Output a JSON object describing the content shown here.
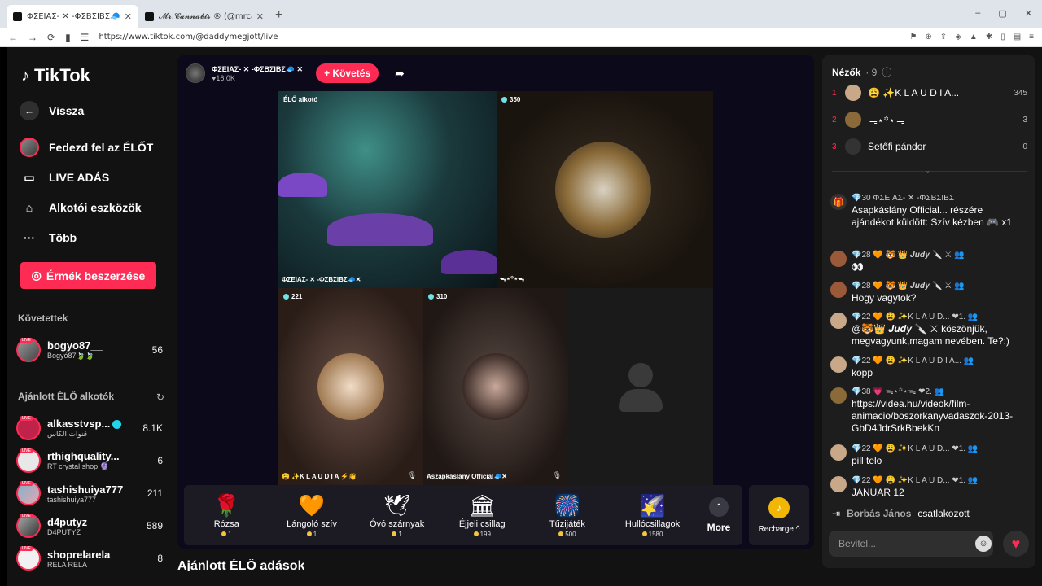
{
  "browser": {
    "tabs": [
      {
        "label": "ΦΣΕΙΑΣ- ✕ -ΦΣΒΣΙΒΣ🧢 (@da",
        "active": true
      },
      {
        "label": "𝓜𝓻.𝓒𝓪𝓷𝓷𝓪𝓫𝓲𝓼 ® (@mrcannabis_)",
        "active": false
      }
    ],
    "new_tab": "+",
    "url": "https://www.tiktok.com/@daddymegjott/live",
    "window_controls": [
      "–",
      "▢",
      "✕"
    ]
  },
  "sidebar": {
    "logo_text": "TikTok",
    "back_label": "Vissza",
    "nav": [
      {
        "label": "Fedezd fel az ÉLŐT",
        "icon": "avatar-icon"
      },
      {
        "label": "LIVE ADÁS",
        "icon": "camera-icon"
      },
      {
        "label": "Alkotói eszközök",
        "icon": "home-tools-icon"
      },
      {
        "label": "Több",
        "icon": "more-dots-icon"
      }
    ],
    "coin_button": "Érmék beszerzése",
    "followed_title": "Követettek",
    "followed": [
      {
        "name": "bogyo87__",
        "sub": "Bogyó87🍃🍃",
        "count": "56"
      }
    ],
    "recommended_title": "Ajánlott ÉLŐ alkotók",
    "recommended": [
      {
        "name": "alkasstvsp...",
        "sub": "قنوات الكاس",
        "count": "8.1K",
        "verified": true
      },
      {
        "name": "rthighquality...",
        "sub": "RT crystal shop 🔮",
        "count": "6"
      },
      {
        "name": "tashishuiya777",
        "sub": "tashishuiya777",
        "count": "211"
      },
      {
        "name": "d4putyz",
        "sub": "D4PUTYZ",
        "count": "589"
      },
      {
        "name": "shoprelarela",
        "sub": "RELA RELA",
        "count": "8"
      }
    ]
  },
  "stage": {
    "host_name": "ΦΣΕΙΑΣ- ✕ -ΦΣΒΣΙΒΣ🧢 ✕",
    "host_likes": "♥16.0K",
    "follow_label": "+ Követés",
    "cells": [
      {
        "tag": "ÉLŐ alkotó",
        "bottom": "ΦΣΕΙΑΣ- ✕ -ΦΣΒΣΙΒΣ🧢✕"
      },
      {
        "tag": "350",
        "bottom": "ᯓ⋆꙳⋆ᯓ"
      },
      {
        "tag": "221",
        "bottom": "😩 ✨K L A U D I A ⚡👋"
      },
      {
        "tag": "310",
        "bottom": "Aszapkáslány Official🧢✕"
      }
    ],
    "gifts": [
      {
        "name": "Rózsa",
        "price": "1",
        "icon": "🌹"
      },
      {
        "name": "Lángoló szív",
        "price": "1",
        "icon": "🧡"
      },
      {
        "name": "Óvó szárnyak",
        "price": "1",
        "icon": "🕊"
      },
      {
        "name": "Éjjeli csillag",
        "price": "199",
        "icon": "🏛"
      },
      {
        "name": "Tűzijáték",
        "price": "500",
        "icon": "🎆"
      },
      {
        "name": "Hullócsillagok",
        "price": "1580",
        "icon": "🌠"
      }
    ],
    "more_label": "More",
    "recharge_label": "Recharge ^",
    "below_title": "Ajánlott ÉLŐ adások"
  },
  "chat": {
    "viewers_title": "Nézők",
    "viewers_count": "· 9",
    "viewers": [
      {
        "rank": "1",
        "name": "😩 ✨K L A U D I A...",
        "score": "345"
      },
      {
        "rank": "2",
        "name": "ᯓ⋆꙳⋆ᯓ",
        "score": "3"
      },
      {
        "rank": "3",
        "name": "Setőfi pándor",
        "score": "0"
      }
    ],
    "messages": [
      {
        "meta": "💎30  ΦΣΕΙΑΣ- ✕ -ΦΣΒΣΙΒΣ",
        "text": "Asapkáslány Official... részére ajándékot küldött: Szív kézben 🎮 x1"
      },
      {
        "meta": "💎28 🧡 🐯 👑 𝑱𝒖𝒅𝒚 🔪 ⚔ 👥",
        "text": "👀"
      },
      {
        "meta": "💎28 🧡 🐯 👑 𝑱𝒖𝒅𝒚 🔪 ⚔ 👥",
        "text": "Hogy vagytok?"
      },
      {
        "meta": "💎22 🧡 😩 ✨K L A U D... ❤1. 👥",
        "text": "@🐯👑 𝑱𝒖𝒅𝒚 🔪 ⚔ köszönjük, megvagyunk,magam nevében. Te?:)"
      },
      {
        "meta": "💎22 🧡 😩 ✨K L A U D I A... 👥",
        "text": "kopp"
      },
      {
        "meta": "💎38 💗 ᯓ⋆꙳⋆ᯓ ❤2. 👥",
        "text": "https://videa.hu/videok/film-animacio/boszorkanyvadaszok-2013-GbD4JdrSrkBbekKn"
      },
      {
        "meta": "💎22 🧡 😩 ✨K L A U D... ❤1. 👥",
        "text": "pill telo"
      },
      {
        "meta": "💎22 🧡 😩 ✨K L A U D... ❤1. 👥",
        "text": "JANUAR 12"
      }
    ],
    "join_name": "Borbás János",
    "join_text": "csatlakozott",
    "input_placeholder": "Bevitel..."
  }
}
